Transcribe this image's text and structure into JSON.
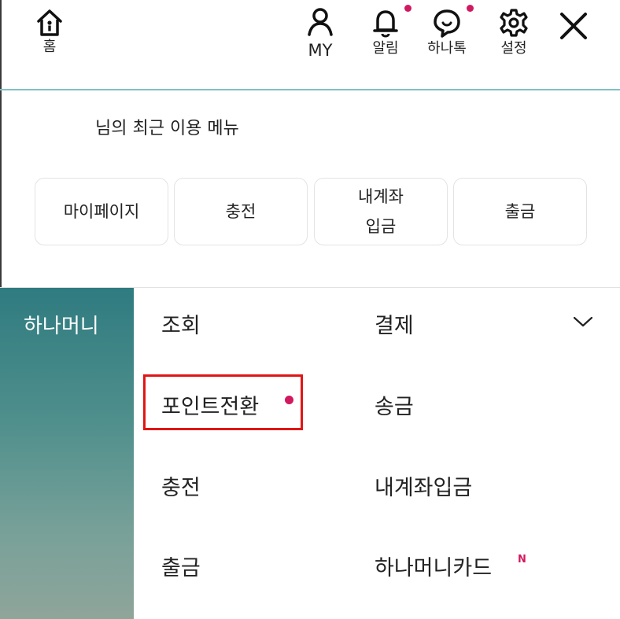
{
  "topbar": {
    "home_label": "홈",
    "my_label": "MY",
    "alarm_label": "알림",
    "talk_label": "하나톡",
    "settings_label": "설정",
    "icons": {
      "home": "home-icon",
      "my": "user-icon",
      "alarm": "bell-icon",
      "talk": "chat-icon",
      "settings": "gear-icon",
      "close": "close-icon"
    },
    "dot_color": "#d1195f",
    "divider_color": "#7fc0c3"
  },
  "recent": {
    "title": "님의 최근 이용 메뉴",
    "buttons": [
      {
        "line1": "마이페이지",
        "line2": ""
      },
      {
        "line1": "충전",
        "line2": ""
      },
      {
        "line1": "내계좌",
        "line2": "입금"
      },
      {
        "line1": "출금",
        "line2": ""
      }
    ]
  },
  "sidebar": {
    "category": "하나머니",
    "gradient_colors": [
      "#2f7b80",
      "#8fa59a"
    ]
  },
  "menu": {
    "col1": [
      "조회",
      "포인트전환",
      "충전",
      "출금"
    ],
    "col2": [
      "결제",
      "송금",
      "내계좌입금",
      "하나머니카드"
    ],
    "new_badge": "N",
    "highlight_color": "#e01515"
  }
}
